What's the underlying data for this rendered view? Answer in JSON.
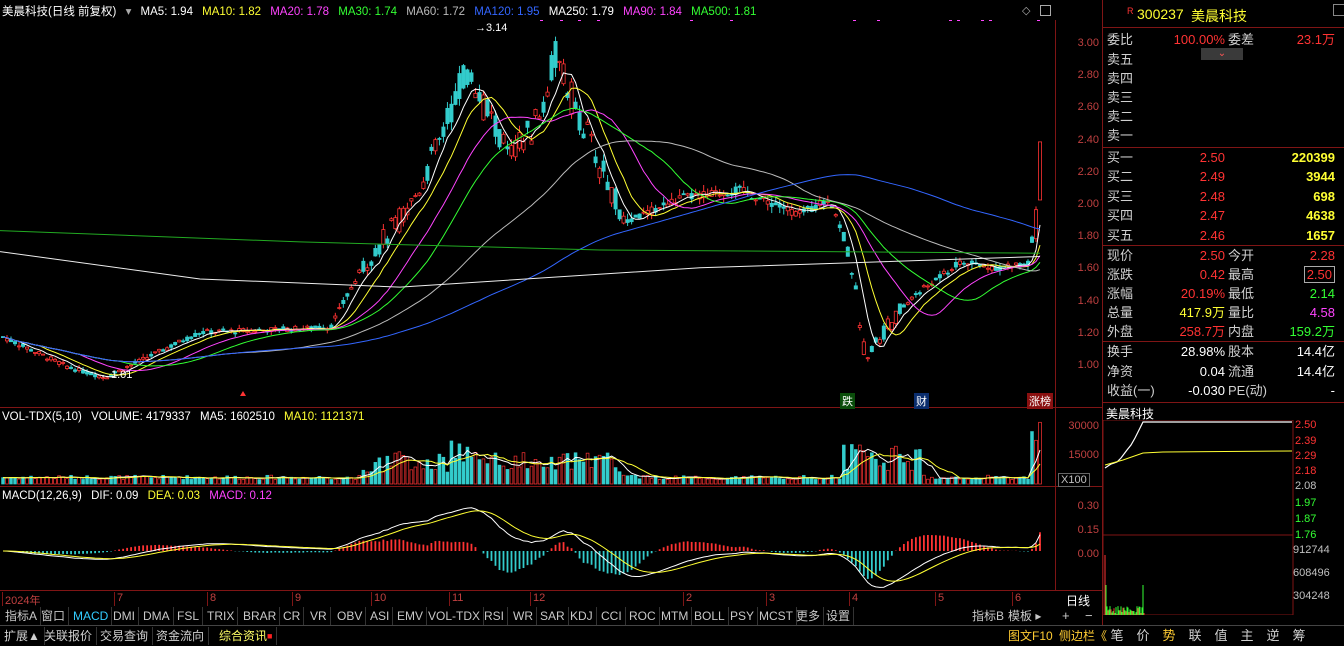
{
  "main_header": {
    "title": "美晨科技(日线 前复权)",
    "ma5": "MA5: 1.94",
    "ma10": "MA10: 1.82",
    "ma20": "MA20: 1.78",
    "ma30": "MA30: 1.74",
    "ma60": "MA60: 1.72",
    "ma120": "MA120: 1.95",
    "ma250": "MA250: 1.79",
    "ma90": "MA90: 1.84",
    "ma500": "MA500: 1.81"
  },
  "price_axis": [
    "3.00",
    "2.80",
    "2.60",
    "2.40",
    "2.20",
    "2.00",
    "1.80",
    "1.60",
    "1.40",
    "1.20",
    "1.00"
  ],
  "annotations": {
    "high": "3.14",
    "low": "1.01",
    "mark1": "跌",
    "mark2": "财",
    "mark3": "涨榜"
  },
  "vol_header": {
    "title": "VOL-TDX(5,10)",
    "volume": "VOLUME: 4179337",
    "ma5": "MA5: 1602510",
    "ma10": "MA10: 1121371"
  },
  "vol_axis": [
    "30000",
    "15000"
  ],
  "vol_unit": "X100",
  "macd_header": {
    "title": "MACD(12,26,9)",
    "dif": "DIF: 0.09",
    "dea": "DEA: 0.03",
    "macd": "MACD: 0.12"
  },
  "macd_axis": [
    "0.30",
    "0.15",
    "0.00"
  ],
  "x_axis": [
    "2024年",
    "7",
    "8",
    "9",
    "10",
    "11",
    "12",
    "2",
    "3",
    "4",
    "5",
    "6"
  ],
  "period_label": "日线",
  "indicator_tabs": [
    "指标A",
    "窗口",
    "MACD",
    "DMI",
    "DMA",
    "FSL",
    "TRIX",
    "BRAR",
    "CR",
    "VR",
    "OBV",
    "ASI",
    "EMV",
    "VOL-TDX",
    "RSI",
    "WR",
    "SAR",
    "KDJ",
    "CCI",
    "ROC",
    "MTM",
    "BOLL",
    "PSY",
    "MCST",
    "更多",
    "设置"
  ],
  "indicator_right": [
    "指标B",
    "模板"
  ],
  "bottom_tabs": [
    "扩展▲",
    "关联报价",
    "交易查询",
    "资金流向",
    "综合资讯"
  ],
  "bottom_right": [
    "图文F10",
    "侧边栏《"
  ],
  "bottom_buttons": [
    "笔",
    "价",
    "势",
    "联",
    "值",
    "主",
    "逆",
    "筹"
  ],
  "stock": {
    "code": "300237",
    "name": "美晨科技",
    "flag": "R"
  },
  "order": {
    "wb_label": "委比",
    "wb_value": "100.00%",
    "wc_label": "委差",
    "wc_value": "23.1万"
  },
  "sells": [
    {
      "label": "卖五",
      "price": "",
      "vol": ""
    },
    {
      "label": "卖四",
      "price": "",
      "vol": ""
    },
    {
      "label": "卖三",
      "price": "",
      "vol": ""
    },
    {
      "label": "卖二",
      "price": "",
      "vol": ""
    },
    {
      "label": "卖一",
      "price": "",
      "vol": ""
    }
  ],
  "buys": [
    {
      "label": "买一",
      "price": "2.50",
      "vol": "220399"
    },
    {
      "label": "买二",
      "price": "2.49",
      "vol": "3944"
    },
    {
      "label": "买三",
      "price": "2.48",
      "vol": "698"
    },
    {
      "label": "买四",
      "price": "2.47",
      "vol": "4638"
    },
    {
      "label": "买五",
      "price": "2.46",
      "vol": "1657"
    }
  ],
  "quote": [
    {
      "l1": "现价",
      "v1": "2.50",
      "l2": "今开",
      "v2": "2.28"
    },
    {
      "l1": "涨跌",
      "v1": "0.42",
      "l2": "最高",
      "v2": "2.50"
    },
    {
      "l1": "涨幅",
      "v1": "20.19%",
      "l2": "最低",
      "v2": "2.14"
    },
    {
      "l1": "总量",
      "v1": "417.9万",
      "l2": "量比",
      "v2": "4.58"
    },
    {
      "l1": "外盘",
      "v1": "258.7万",
      "l2": "内盘",
      "v2": "159.2万"
    }
  ],
  "quote2": [
    {
      "l1": "换手",
      "v1": "28.98%",
      "l2": "股本",
      "v2": "14.4亿"
    },
    {
      "l1": "净资",
      "v1": "0.04",
      "l2": "流通",
      "v2": "14.4亿"
    },
    {
      "l1": "收益(一)",
      "v1": "-0.030",
      "l2": "PE(动)",
      "v2": "-"
    }
  ],
  "mini": {
    "title": "美晨科技",
    "price_axis": [
      "2.50",
      "2.39",
      "2.29",
      "2.18",
      "2.08"
    ],
    "pct_axis": [
      "1.97",
      "1.87",
      "1.76"
    ],
    "vol_axis": [
      "912744",
      "608496",
      "304248"
    ]
  },
  "colors": {
    "up": "#ff3333",
    "down": "#33cccc",
    "grid": "#7f1515",
    "bg": "#000000"
  },
  "chart_data": {
    "type": "candlestick",
    "xlabels": [
      "2024年",
      "7",
      "8",
      "9",
      "10",
      "11",
      "12",
      "2",
      "3",
      "4",
      "5",
      "6"
    ],
    "ylim": [
      0.95,
      3.15
    ],
    "key_points": [
      {
        "label": "start",
        "close": 1.3
      },
      {
        "label": "low",
        "value": 1.01
      },
      {
        "label": "Oct rally",
        "close": 1.8
      },
      {
        "label": "Nov high",
        "value": 3.14
      },
      {
        "label": "Dec high",
        "close": 3.05
      },
      {
        "label": "Jan",
        "close": 2.2
      },
      {
        "label": "Mar",
        "close": 2.1
      },
      {
        "label": "Apr low",
        "close": 1.15
      },
      {
        "label": "May",
        "close": 1.75
      },
      {
        "label": "Jun last",
        "close": 2.5
      }
    ],
    "macd": {
      "dif": 0.09,
      "dea": 0.03,
      "macd": 0.12
    },
    "volume_last": 4179337
  }
}
